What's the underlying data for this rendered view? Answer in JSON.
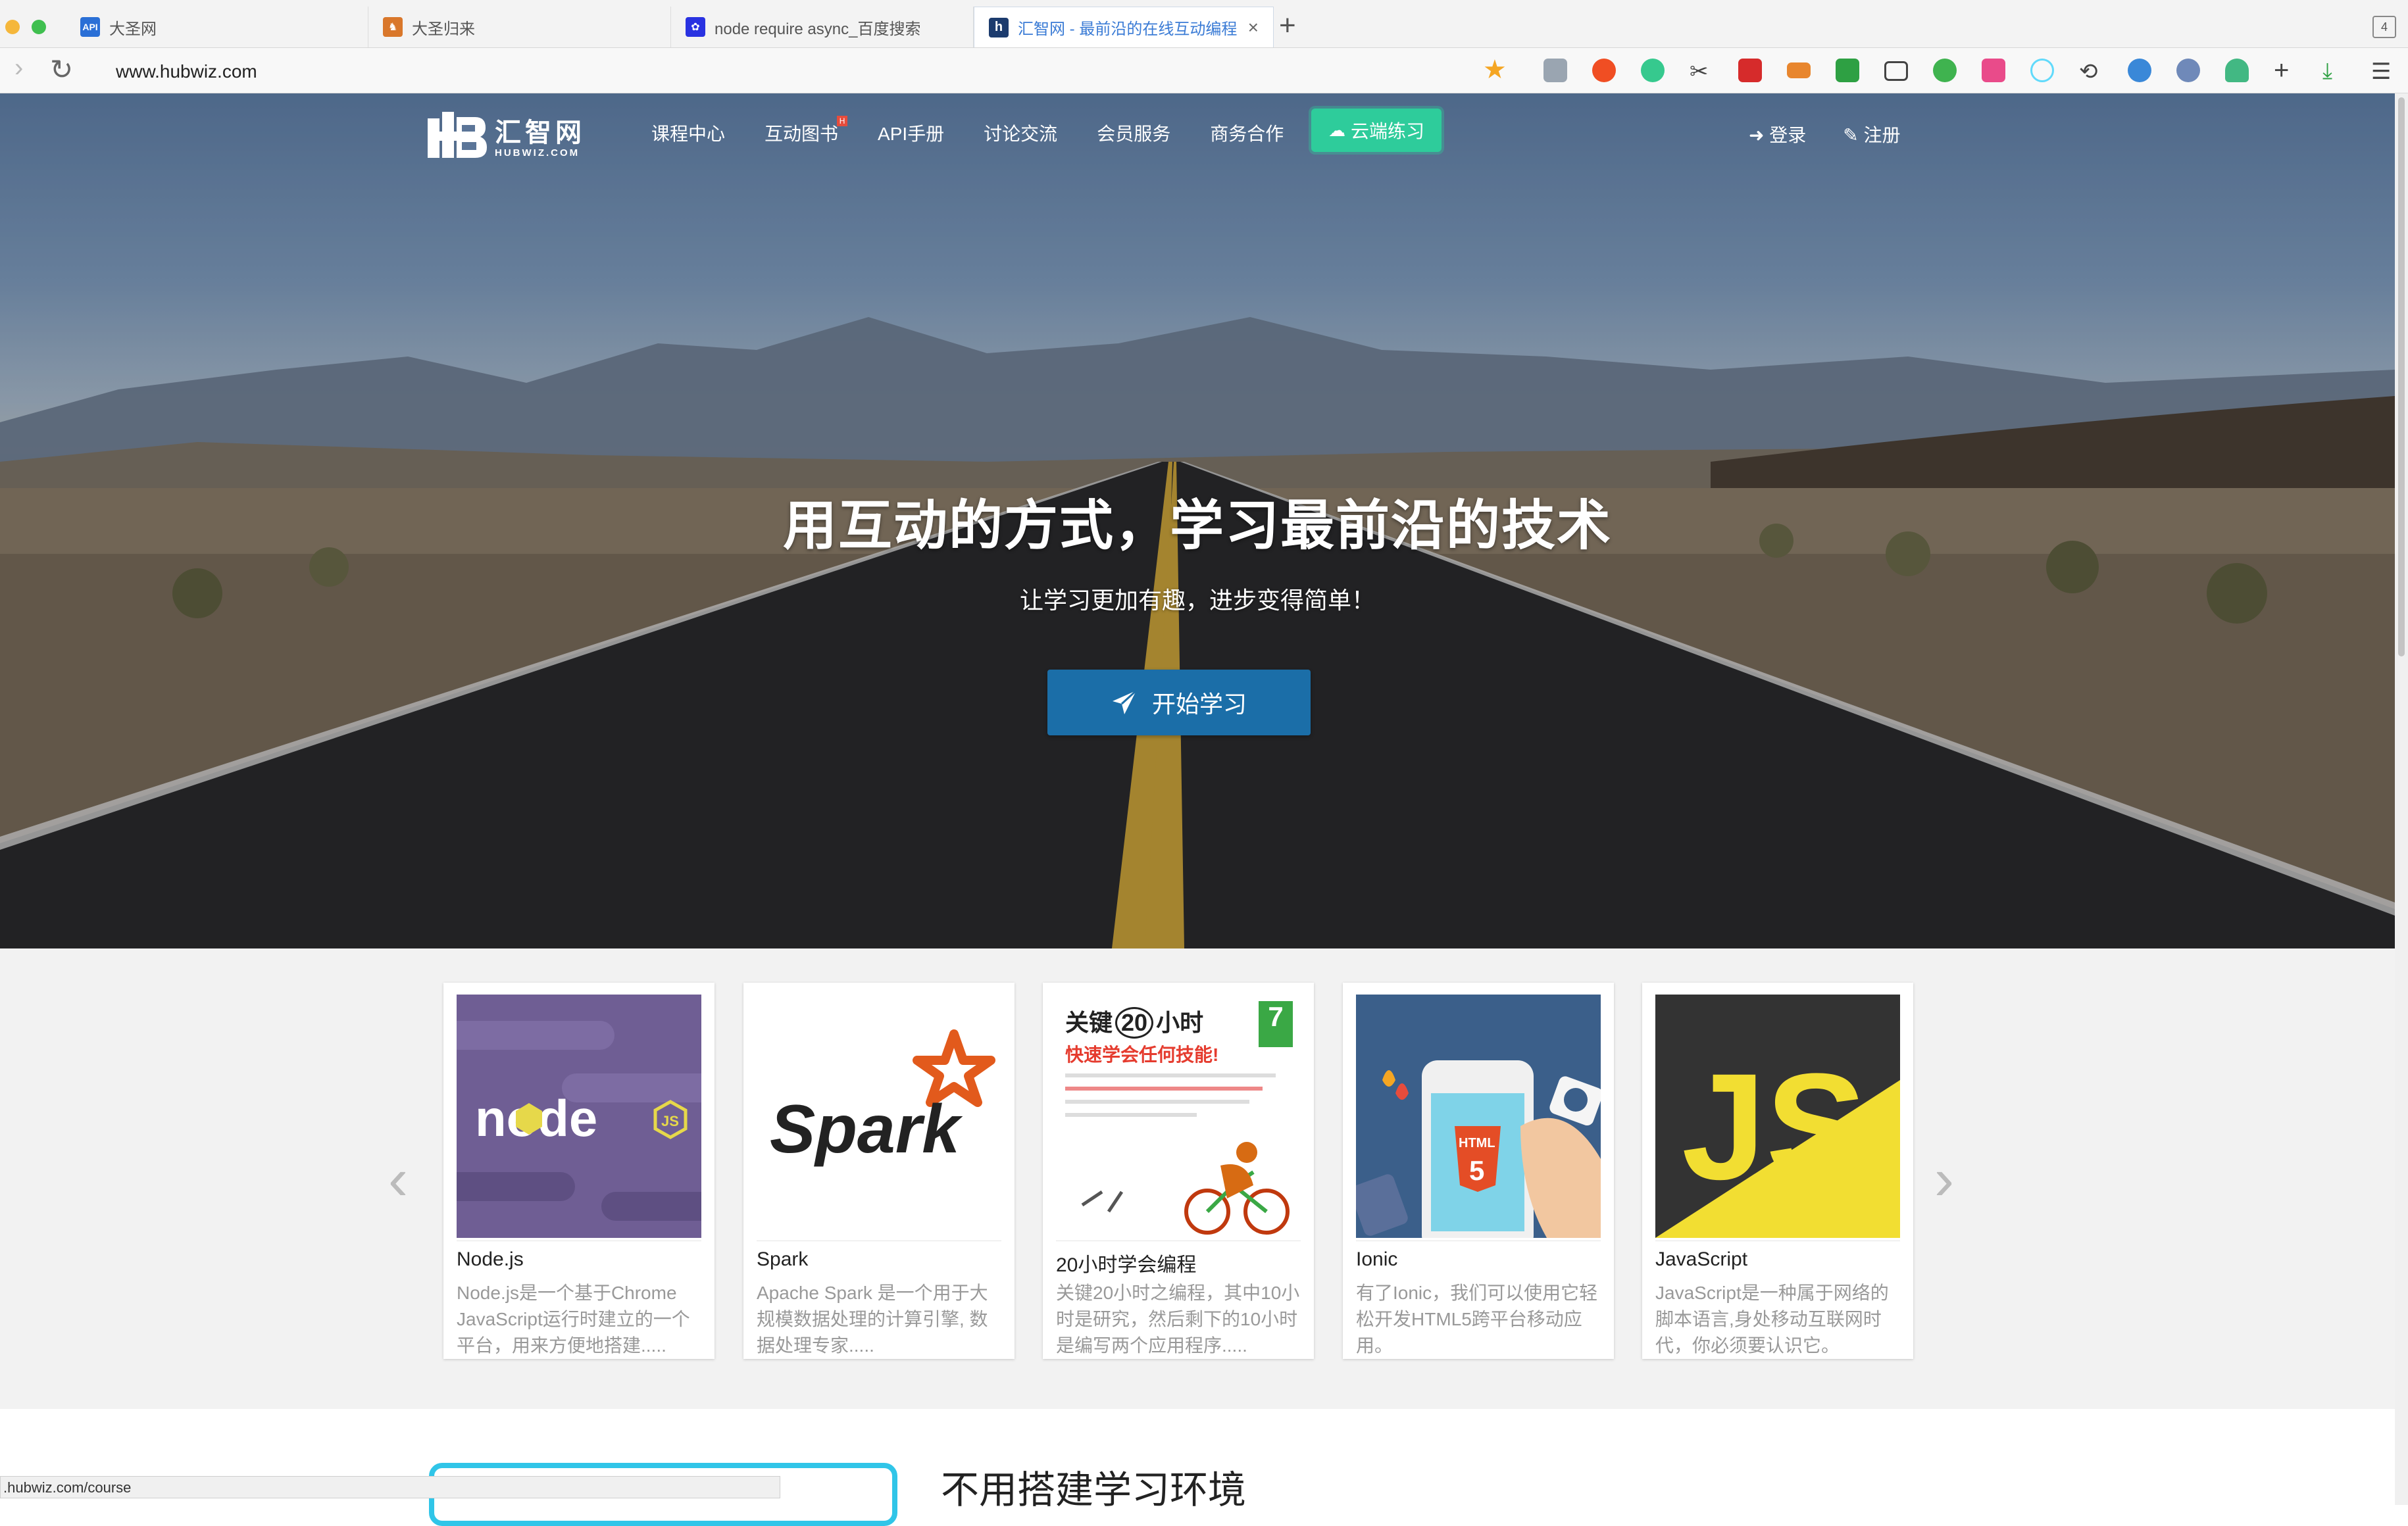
{
  "browser": {
    "tabs": [
      {
        "title": "大圣网",
        "favicon": "api-icon",
        "active": false
      },
      {
        "title": "大圣归来",
        "favicon": "monkey-icon",
        "active": false
      },
      {
        "title": "node require async_百度搜索",
        "favicon": "baidu-paw-icon",
        "active": false
      },
      {
        "title": "汇智网 - 最前沿的在线互动编程",
        "favicon": "hubwiz-h-icon",
        "active": true
      }
    ],
    "tab_count": "4",
    "url": "www.hubwiz.com",
    "status_url": ".hubwiz.com/course"
  },
  "site": {
    "logo_cn": "汇智网",
    "logo_en": "HUBWIZ.COM",
    "nav": [
      {
        "label": "课程中心"
      },
      {
        "label": "互动图书",
        "badge": "H"
      },
      {
        "label": "API手册"
      },
      {
        "label": "讨论交流"
      },
      {
        "label": "会员服务"
      },
      {
        "label": "商务合作"
      }
    ],
    "cloud_button": "云端练习",
    "login": "登录",
    "register": "注册"
  },
  "hero": {
    "title": "用互动的方式，学习最前沿的技术",
    "subtitle": "让学习更加有趣，进步变得简单！",
    "button": "开始学习"
  },
  "courses": [
    {
      "title": "Node.js",
      "desc": "Node.js是一个基于Chrome JavaScript运行时建立的一个平台，用来方便地搭建.....",
      "thumb": "nodejs-logo"
    },
    {
      "title": "Spark",
      "desc": "Apache Spark 是一个用于大规模数据处理的计算引擎, 数据处理专家.....",
      "thumb": "spark-logo"
    },
    {
      "title": "20小时学会编程",
      "desc": "关键20小时之编程，其中10小时是研究，然后剩下的10小时是编写两个应用程序.....",
      "thumb": "book-cover"
    },
    {
      "title": "Ionic",
      "desc": "有了Ionic，我们可以使用它轻松开发HTML5跨平台移动应用。",
      "thumb": "ionic-html5-phone"
    },
    {
      "title": "JavaScript",
      "desc": "JavaScript是一种属于网络的脚本语言,身处移动互联网时代，你必须要认识它。",
      "thumb": "js-logo"
    }
  ],
  "book_cover": {
    "title_a": "关键",
    "title_num": "20",
    "title_b": "小时",
    "subtitle": "快速学会任何技能!",
    "badge": "7"
  },
  "thumb_text": {
    "node": "node",
    "node_badge": "JS",
    "spark": "Spark",
    "html5": "HTML",
    "html5_num": "5",
    "js": "JS"
  },
  "section": {
    "heading": "不用搭建学习环境"
  },
  "colors": {
    "primary_button": "#1b6ea8",
    "cloud_button": "#2ecc9b",
    "accent_cyan": "#30c5e8"
  }
}
